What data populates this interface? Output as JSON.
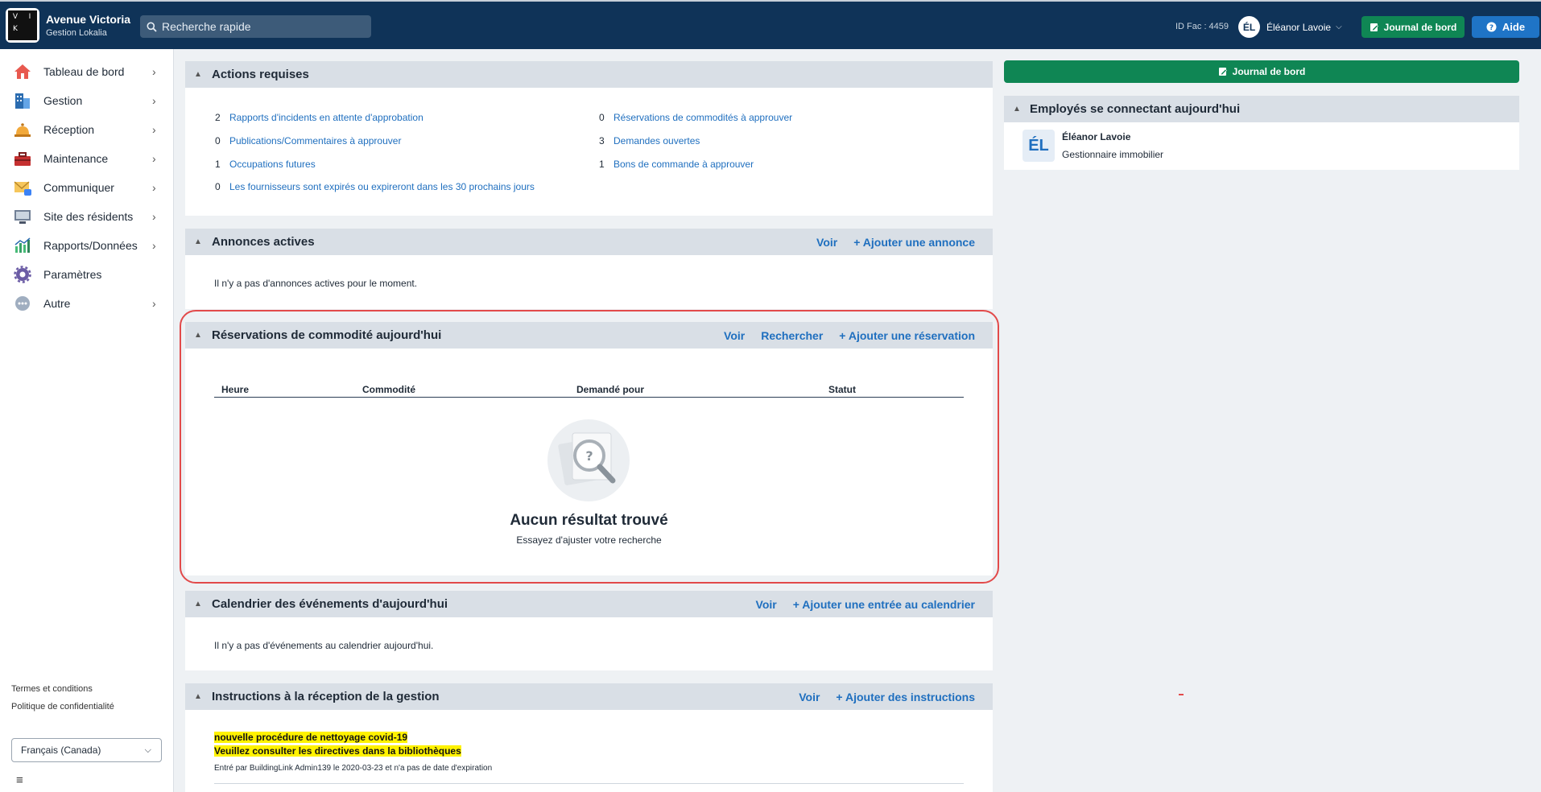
{
  "header": {
    "logo_letters": [
      "V",
      "I",
      "K",
      ""
    ],
    "org_name": "Avenue Victoria",
    "org_sub": "Gestion Lokalia",
    "search_placeholder": "Recherche rapide",
    "id_fac": "ID Fac : 4459",
    "user_initials": "ÉL",
    "user_name": "Éléanor Lavoie",
    "journal_label": "Journal de bord",
    "help_label": "Aide"
  },
  "sidebar": {
    "items": [
      {
        "label": "Tableau de bord"
      },
      {
        "label": "Gestion"
      },
      {
        "label": "Réception"
      },
      {
        "label": "Maintenance"
      },
      {
        "label": "Communiquer"
      },
      {
        "label": "Site des résidents"
      },
      {
        "label": "Rapports/Données"
      },
      {
        "label": "Paramètres"
      },
      {
        "label": "Autre"
      }
    ],
    "terms": "Termes et conditions",
    "privacy": "Politique de confidentialité",
    "language": "Français (Canada)"
  },
  "actions": {
    "title": "Actions requises",
    "left": [
      {
        "count": "2",
        "label": "Rapports d'incidents en attente d'approbation"
      },
      {
        "count": "0",
        "label": "Publications/Commentaires à approuver"
      },
      {
        "count": "1",
        "label": "Occupations futures"
      },
      {
        "count": "0",
        "label": "Les fournisseurs sont expirés ou expireront dans les 30 prochains jours"
      }
    ],
    "right": [
      {
        "count": "0",
        "label": "Réservations de commodités à approuver"
      },
      {
        "count": "3",
        "label": "Demandes ouvertes"
      },
      {
        "count": "1",
        "label": "Bons de commande à approuver"
      }
    ]
  },
  "announcements": {
    "title": "Annonces actives",
    "view": "Voir",
    "add": "+ Ajouter une annonce",
    "empty": "Il n'y a pas d'annonces actives pour le moment."
  },
  "reservations": {
    "title": "Réservations de commodité aujourd'hui",
    "view": "Voir",
    "search": "Rechercher",
    "add": "+ Ajouter une réservation",
    "columns": [
      "Heure",
      "Commodité",
      "Demandé pour",
      "Statut"
    ],
    "empty_title": "Aucun résultat trouvé",
    "empty_sub": "Essayez d'ajuster votre recherche"
  },
  "calendar": {
    "title": "Calendrier des événements d'aujourd'hui",
    "view": "Voir",
    "add": "+ Ajouter une entrée au calendrier",
    "empty": "Il n'y a pas d'événements au calendrier aujourd'hui."
  },
  "instructions": {
    "title": "Instructions à la réception de la gestion",
    "view": "Voir",
    "add": "+ Ajouter des instructions",
    "line1": "nouvelle procédure de nettoyage covid-19",
    "line2": "Veuillez consulter les directives dans la bibliothèques",
    "meta": "Entré par BuildingLink Admin139 le 2020-03-23 et n'a pas de date d'expiration"
  },
  "right_panel": {
    "journal_label": "Journal de bord",
    "employees_title": "Employés se connectant aujourd'hui",
    "employee_initials": "ÉL",
    "employee_name": "Éléanor Lavoie",
    "employee_role": "Gestionnaire immobilier"
  },
  "colors": {
    "topbar": "#0f3358",
    "green": "#0f8654",
    "blue": "#1f74c6",
    "link": "#1f6fbf",
    "highlight": "#fff200",
    "ring": "#e24a4a"
  }
}
